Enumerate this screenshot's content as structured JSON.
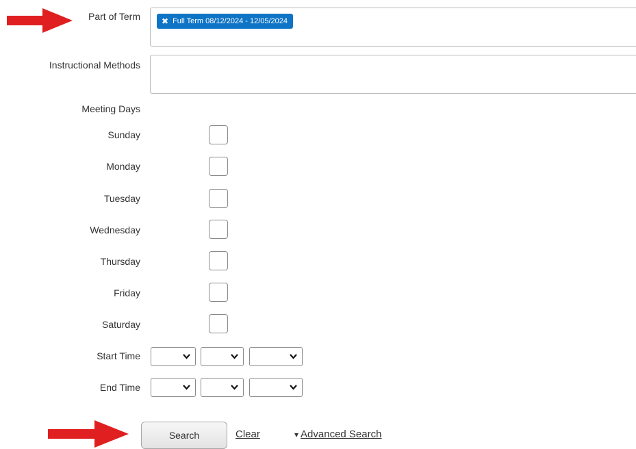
{
  "part_of_term": {
    "label": "Part of Term",
    "selected_chip": "Full Term 08/12/2024 - 12/05/2024",
    "remove_glyph": "✖"
  },
  "instructional_methods": {
    "label": "Instructional Methods"
  },
  "meeting_days": {
    "label": "Meeting Days",
    "days": [
      "Sunday",
      "Monday",
      "Tuesday",
      "Wednesday",
      "Thursday",
      "Friday",
      "Saturday"
    ]
  },
  "start_time": {
    "label": "Start Time"
  },
  "end_time": {
    "label": "End Time"
  },
  "actions": {
    "search_label": "Search",
    "clear_label": "Clear",
    "advanced_search_label": "Advanced Search",
    "advanced_caret": "▾"
  },
  "colors": {
    "chip_blue": "#0e74c6",
    "annotation_arrow_red": "#e02020"
  },
  "icons": {
    "annotation": "red-arrow-icon",
    "dropdown": "chevron-down-icon",
    "remove": "close-icon"
  }
}
